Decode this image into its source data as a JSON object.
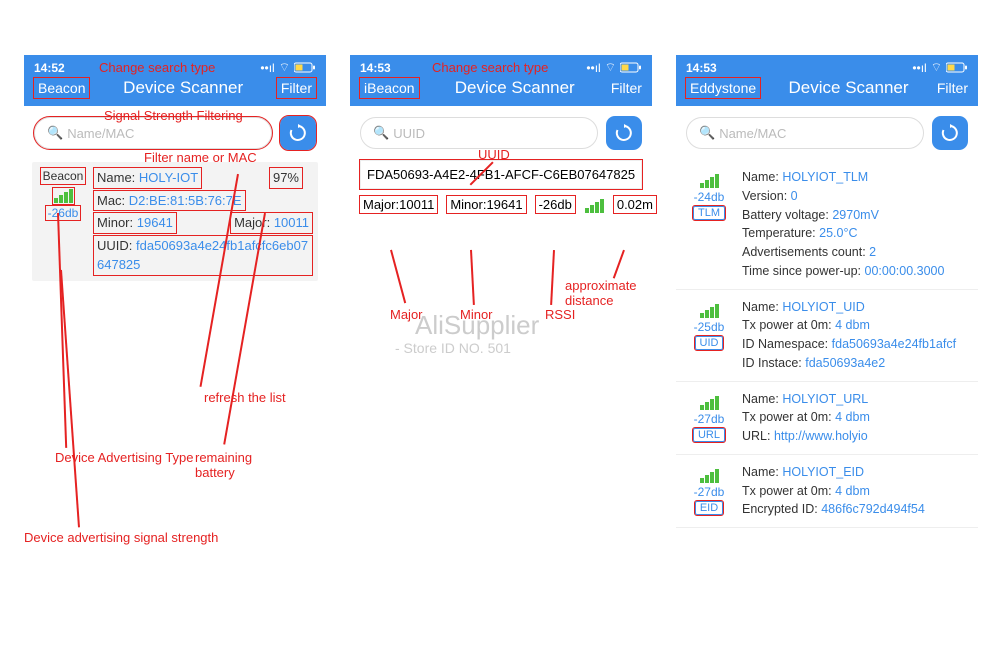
{
  "p1": {
    "time": "14:52",
    "type": "Beacon",
    "title": "Device Scanner",
    "filter": "Filter",
    "search_ph": "Name/MAC",
    "card": {
      "type": "Beacon",
      "name_k": "Name:",
      "name_v": "HOLY-IOT",
      "pct": "97%",
      "mac_k": "Mac:",
      "mac_v": "D2:BE:81:5B:76:7E",
      "minor_k": "Minor:",
      "minor_v": "19641",
      "major_k": "Major:",
      "major_v": "10011",
      "uuid_k": "UUID:",
      "uuid_v": "fda50693a4e24fb1afcfc6eb07647825",
      "rssi": "-26db"
    },
    "ann": {
      "change": "Change search type",
      "sigfilt": "Signal Strength Filtering",
      "namefilt": "Filter name or MAC",
      "refresh": "refresh the list",
      "devtype": "Device Advertising Type",
      "batt": "remaining battery",
      "sigstr": "Device advertising signal strength"
    }
  },
  "p2": {
    "time": "14:53",
    "type": "iBeacon",
    "title": "Device Scanner",
    "filter": "Filter",
    "search_ph": "UUID",
    "uuid": "FDA50693-A4E2-4FB1-AFCF-C6EB07647825",
    "major_k": "Major:",
    "major_v": "10011",
    "minor_k": "Minor:",
    "minor_v": "19641",
    "rssi": "-26db",
    "dist": "0.02m",
    "ann": {
      "change": "Change search type",
      "uuid": "UUID",
      "major": "Major",
      "minor": "Minor",
      "rssi": "RSSI",
      "dist": "approximate distance"
    }
  },
  "p3": {
    "time": "14:53",
    "type": "Eddystone",
    "title": "Device Scanner",
    "filter": "Filter",
    "search_ph": "Name/MAC",
    "tlm": {
      "rssi": "-24db",
      "tag": "TLM",
      "name_k": "Name:",
      "name_v": "HOLYIOT_TLM",
      "ver_k": "Version:",
      "ver_v": "0",
      "bv_k": "Battery voltage:",
      "bv_v": "2970mV",
      "temp_k": "Temperature:",
      "temp_v": "25.0°C",
      "adv_k": "Advertisements count:",
      "adv_v": "2",
      "tsp_k": "Time since power-up:",
      "tsp_v": "00:00:00.3000"
    },
    "uid": {
      "rssi": "-25db",
      "tag": "UID",
      "name_k": "Name:",
      "name_v": "HOLYIOT_UID",
      "tx_k": "Tx power at 0m:",
      "tx_v": "4 dbm",
      "ns_k": "ID Namespace:",
      "ns_v": "fda50693a4e24fb1afcf",
      "in_k": "ID Instace:",
      "in_v": "fda50693a4e2"
    },
    "url": {
      "rssi": "-27db",
      "tag": "URL",
      "name_k": "Name:",
      "name_v": "HOLYIOT_URL",
      "tx_k": "Tx power at 0m:",
      "tx_v": "4 dbm",
      "url_k": "URL:",
      "url_v": "http://www.holyio"
    },
    "eid": {
      "rssi": "-27db",
      "tag": "EID",
      "name_k": "Name:",
      "name_v": "HOLYIOT_EID",
      "tx_k": "Tx power at 0m:",
      "tx_v": "4 dbm",
      "enc_k": "Encrypted ID:",
      "enc_v": "486f6c792d494f54"
    }
  },
  "wm": {
    "l1": "AliSupplier",
    "l2": "- Store ID NO. 501"
  }
}
